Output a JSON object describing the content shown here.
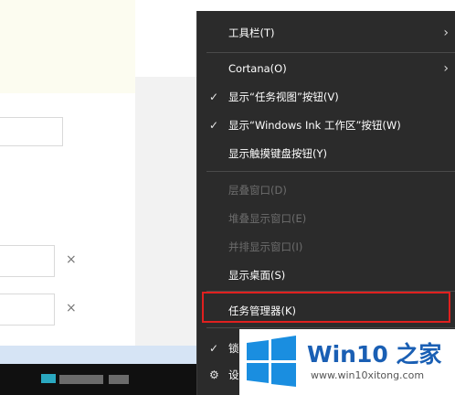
{
  "context_menu": {
    "items": [
      {
        "label": "工具栏(T)",
        "submenu": true
      },
      {
        "label": "Cortana(O)",
        "submenu": true
      },
      {
        "label": "显示“任务视图”按钮(V)",
        "checked": true
      },
      {
        "label": "显示“Windows Ink 工作区”按钮(W)",
        "checked": true
      },
      {
        "label": "显示触摸键盘按钮(Y)"
      },
      {
        "label": "层叠窗口(D)",
        "disabled": true
      },
      {
        "label": "堆叠显示窗口(E)",
        "disabled": true
      },
      {
        "label": "并排显示窗口(I)",
        "disabled": true
      },
      {
        "label": "显示桌面(S)"
      },
      {
        "label": "任务管理器(K)",
        "highlighted": true
      },
      {
        "label": "锁",
        "checked": true
      },
      {
        "label": "设"
      }
    ]
  },
  "form": {
    "remove_symbol": "×"
  },
  "watermark": {
    "title": "Win10 之家",
    "url": "www.win10xitong.com"
  },
  "colors": {
    "menu_bg": "#2b2b2b",
    "highlight": "#e0201f",
    "brand": "#1a5fb4"
  }
}
